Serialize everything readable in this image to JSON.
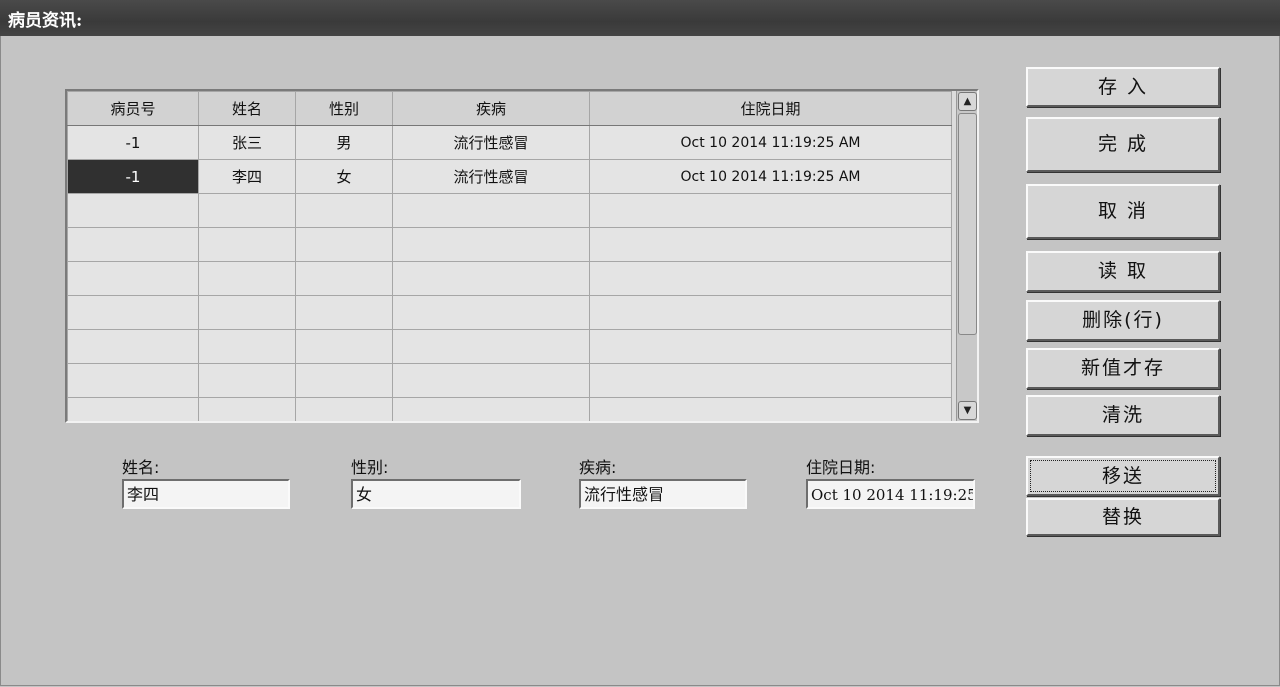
{
  "window": {
    "title": "病员资讯:"
  },
  "grid": {
    "headers": [
      "病员号",
      "姓名",
      "性别",
      "疾病",
      "住院日期"
    ],
    "rows": [
      [
        "-1",
        "张三",
        "男",
        "流行性感冒",
        "Oct 10 2014 11:19:25 AM"
      ],
      [
        "-1",
        "李四",
        "女",
        "流行性感冒",
        "Oct 10 2014 11:19:25 AM"
      ]
    ],
    "selected_row": 1
  },
  "form": {
    "name_label": "姓名:",
    "name_value": "李四",
    "gender_label": "性别:",
    "gender_value": "女",
    "disease_label": "疾病:",
    "disease_value": "流行性感冒",
    "date_label": "住院日期:",
    "date_value": "Oct 10 2014 11:19:25 A"
  },
  "buttons": {
    "store": "存 入",
    "done": "完 成",
    "cancel": "取 消",
    "read": "读 取",
    "delete_row": "删除(行)",
    "save_new": "新值才存",
    "clear": "清洗",
    "transfer": "移送",
    "replace": "替换"
  }
}
